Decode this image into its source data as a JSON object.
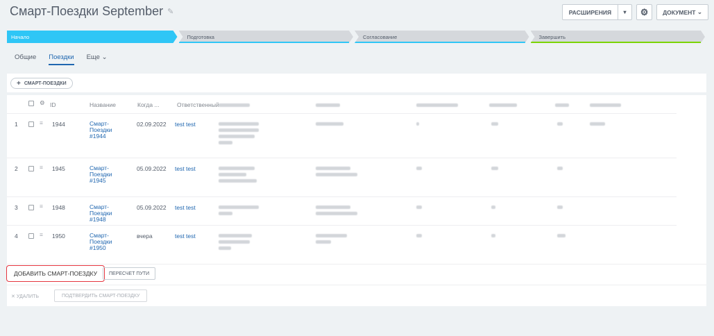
{
  "header": {
    "title": "Смарт-Поездки September",
    "extensions_label": "РАСШИРЕНИЯ",
    "document_label": "ДОКУМЕНТ"
  },
  "stages": [
    {
      "label": "Начало"
    },
    {
      "label": "Подготовка"
    },
    {
      "label": "Согласование"
    },
    {
      "label": "Завершить"
    }
  ],
  "tabs": [
    {
      "label": "Общие"
    },
    {
      "label": "Поездки"
    },
    {
      "label": "Еще"
    }
  ],
  "toolbar": {
    "add_smart_label": "СМАРТ-ПОЕЗДКИ"
  },
  "table": {
    "columns": {
      "id": "ID",
      "name": "Название",
      "when": "Когда ...",
      "owner": "Ответственный"
    },
    "rows": [
      {
        "num": "1",
        "id": "1944",
        "name": "Смарт- Поездки #1944",
        "when": "02.09.2022",
        "owner": "test test"
      },
      {
        "num": "2",
        "id": "1945",
        "name": "Смарт- Поездки #1945",
        "when": "05.09.2022",
        "owner": "test test"
      },
      {
        "num": "3",
        "id": "1948",
        "name": "Смарт- Поездки #1948",
        "when": "05.09.2022",
        "owner": "test test"
      },
      {
        "num": "4",
        "id": "1950",
        "name": "Смарт- Поездки #1950",
        "when": "вчера",
        "owner": "test test"
      }
    ]
  },
  "footer": {
    "add_smart_trip_label": "ДОБАВИТЬ СМАРТ-ПОЕЗДКУ",
    "recalc_label": "ПЕРЕСЧЕТ ПУТИ",
    "delete_label": "УДАЛИТЬ",
    "confirm_label": "ПОДТВЕРДИТЬ СМАРТ-ПОЕЗДКУ"
  },
  "colors": {
    "accent": "#2067b0",
    "stage_active": "#2fc6f6",
    "stage_done": "#7bd500",
    "highlight_border": "#e5353f"
  }
}
